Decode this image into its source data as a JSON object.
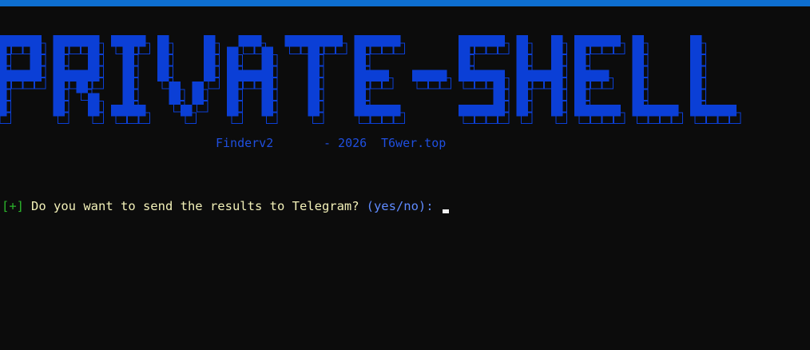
{
  "window": {
    "accent": "#0e6fd1",
    "background": "#0c0c0c"
  },
  "banner": {
    "text": "PRIVATE-SHELL",
    "fill": "#0b3fd6",
    "outline": "#0b3fd6"
  },
  "subtitle": {
    "tool": "Finderv2",
    "year": "- 2026",
    "site": "T6wer.top"
  },
  "prompt": {
    "tag": "[+]",
    "question": "Do you want to send the results to Telegram?",
    "options": "(yes/no):"
  }
}
